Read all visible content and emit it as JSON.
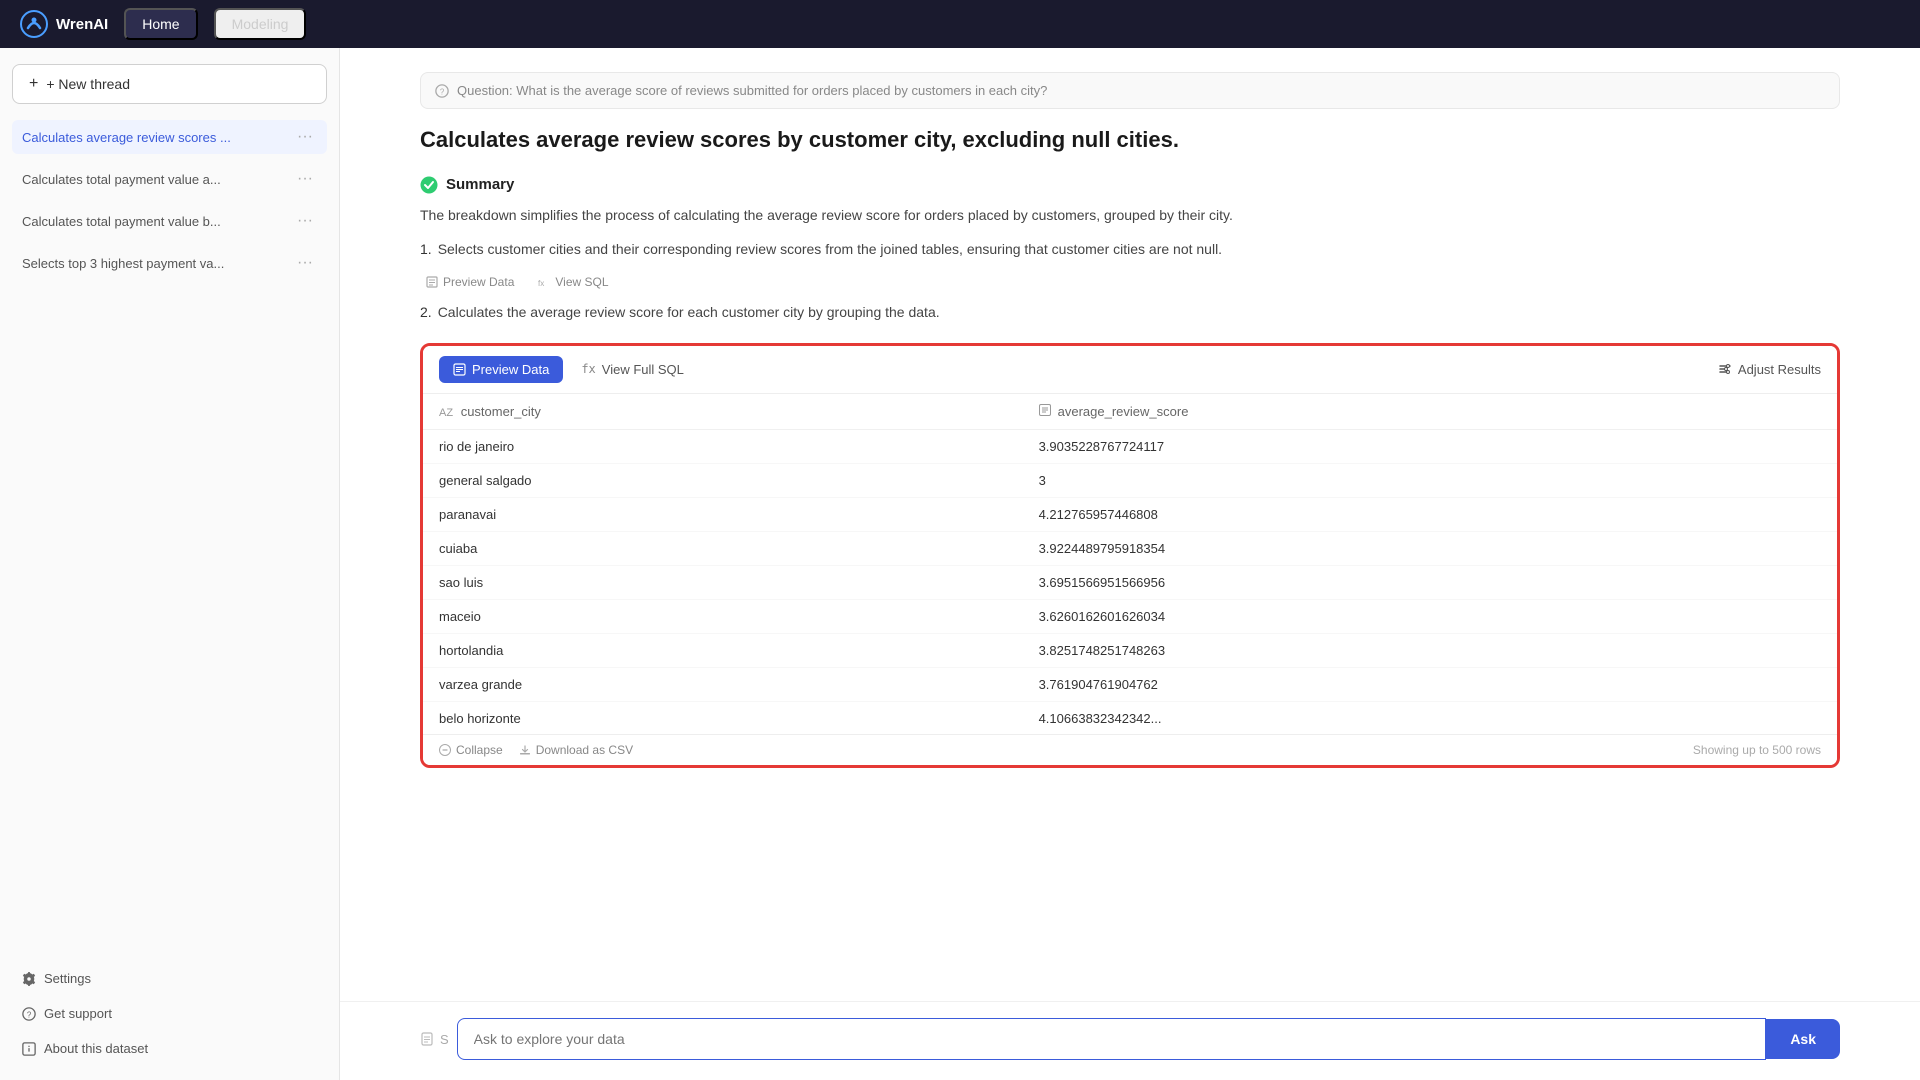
{
  "nav": {
    "logo_text": "WrenAI",
    "tabs": [
      {
        "label": "Home",
        "active": true
      },
      {
        "label": "Modeling",
        "active": false
      }
    ]
  },
  "sidebar": {
    "new_thread_label": "+ New thread",
    "items": [
      {
        "label": "Calculates average review scores ...",
        "active": true
      },
      {
        "label": "Calculates total payment value a...",
        "active": false
      },
      {
        "label": "Calculates total payment value b...",
        "active": false
      },
      {
        "label": "Selects top 3 highest payment va...",
        "active": false
      }
    ],
    "bottom_items": [
      {
        "label": "Settings",
        "icon": "gear"
      },
      {
        "label": "Get support",
        "icon": "help"
      },
      {
        "label": "About this dataset",
        "icon": "info"
      }
    ]
  },
  "content": {
    "question": "Question: What is the average score of reviews submitted for orders placed by customers in each city?",
    "title": "Calculates average review scores by customer city, excluding null cities.",
    "summary_label": "Summary",
    "summary_text": "The breakdown simplifies the process of calculating the average review score for orders placed by customers, grouped by their city.",
    "steps": [
      {
        "num": "1.",
        "text": "Selects customer cities and their corresponding review scores from the joined tables, ensuring that customer cities are not null."
      },
      {
        "num": "2.",
        "text": "Calculates the average review score for each customer city by grouping the data."
      }
    ],
    "step1_actions": {
      "preview_data": "Preview Data",
      "view_sql": "View SQL"
    },
    "card": {
      "tab_preview": "Preview Data",
      "tab_sql": "View Full SQL",
      "adjust_btn": "Adjust Results",
      "table": {
        "columns": [
          {
            "name": "customer_city",
            "type": "text"
          },
          {
            "name": "average_review_score",
            "type": "number"
          }
        ],
        "rows": [
          {
            "city": "rio de janeiro",
            "score": "3.9035228767724117"
          },
          {
            "city": "general salgado",
            "score": "3"
          },
          {
            "city": "paranavai",
            "score": "4.212765957446808"
          },
          {
            "city": "cuiaba",
            "score": "3.9224489795918354"
          },
          {
            "city": "sao luis",
            "score": "3.6951566951566956"
          },
          {
            "city": "maceio",
            "score": "3.6260162601626034"
          },
          {
            "city": "hortolandia",
            "score": "3.8251748251748263"
          },
          {
            "city": "varzea grande",
            "score": "3.761904761904762"
          },
          {
            "city": "belo horizonte",
            "score": "4.10663832342342..."
          }
        ]
      },
      "footer": {
        "collapse": "Collapse",
        "download": "Download as CSV",
        "info": "Showing up to 500 rows"
      }
    }
  },
  "input": {
    "placeholder": "Ask to explore your data",
    "button_label": "Ask",
    "prefix_icon": "document"
  }
}
